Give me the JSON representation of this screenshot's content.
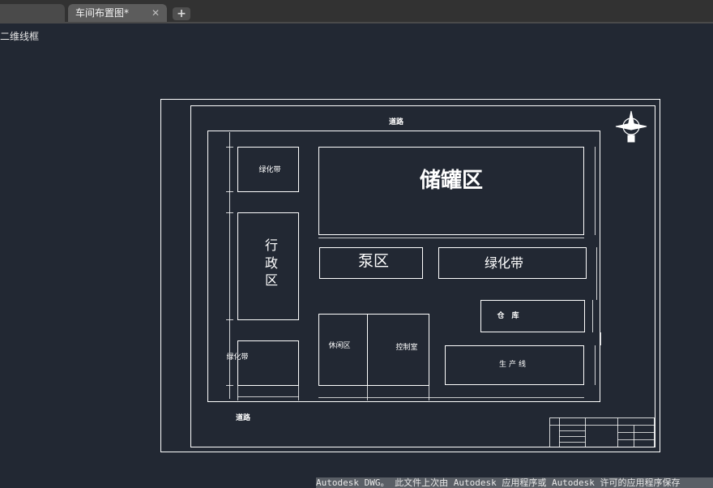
{
  "tabs": {
    "previous_label": "",
    "active_label": "车间布置图*",
    "close_glyph": "✕",
    "new_tab_glyph": "+"
  },
  "view_label": "二维线框",
  "drawing": {
    "road_top": "道路",
    "road_bottom": "道路",
    "zones": {
      "storage_tanks": "储罐区",
      "pump": "泵区",
      "green_belt_right": "绿化带",
      "green_belt_top_left": "绿化带",
      "green_belt_bottom_left": "绿化带",
      "admin_line1": "行",
      "admin_line2": "政",
      "admin_line3": "区",
      "warehouse": "仓　库",
      "rest_area": "休闲区",
      "control_room": "控制室",
      "production_line": "生产线"
    }
  },
  "status_bar": {
    "text": "Autodesk DWG。 此文件上次由 Autodesk 应用程序或 Autodesk 许可的应用程序保存"
  },
  "colors": {
    "background": "#222833",
    "lines": "#ffffff",
    "tab_bar": "#323232"
  }
}
